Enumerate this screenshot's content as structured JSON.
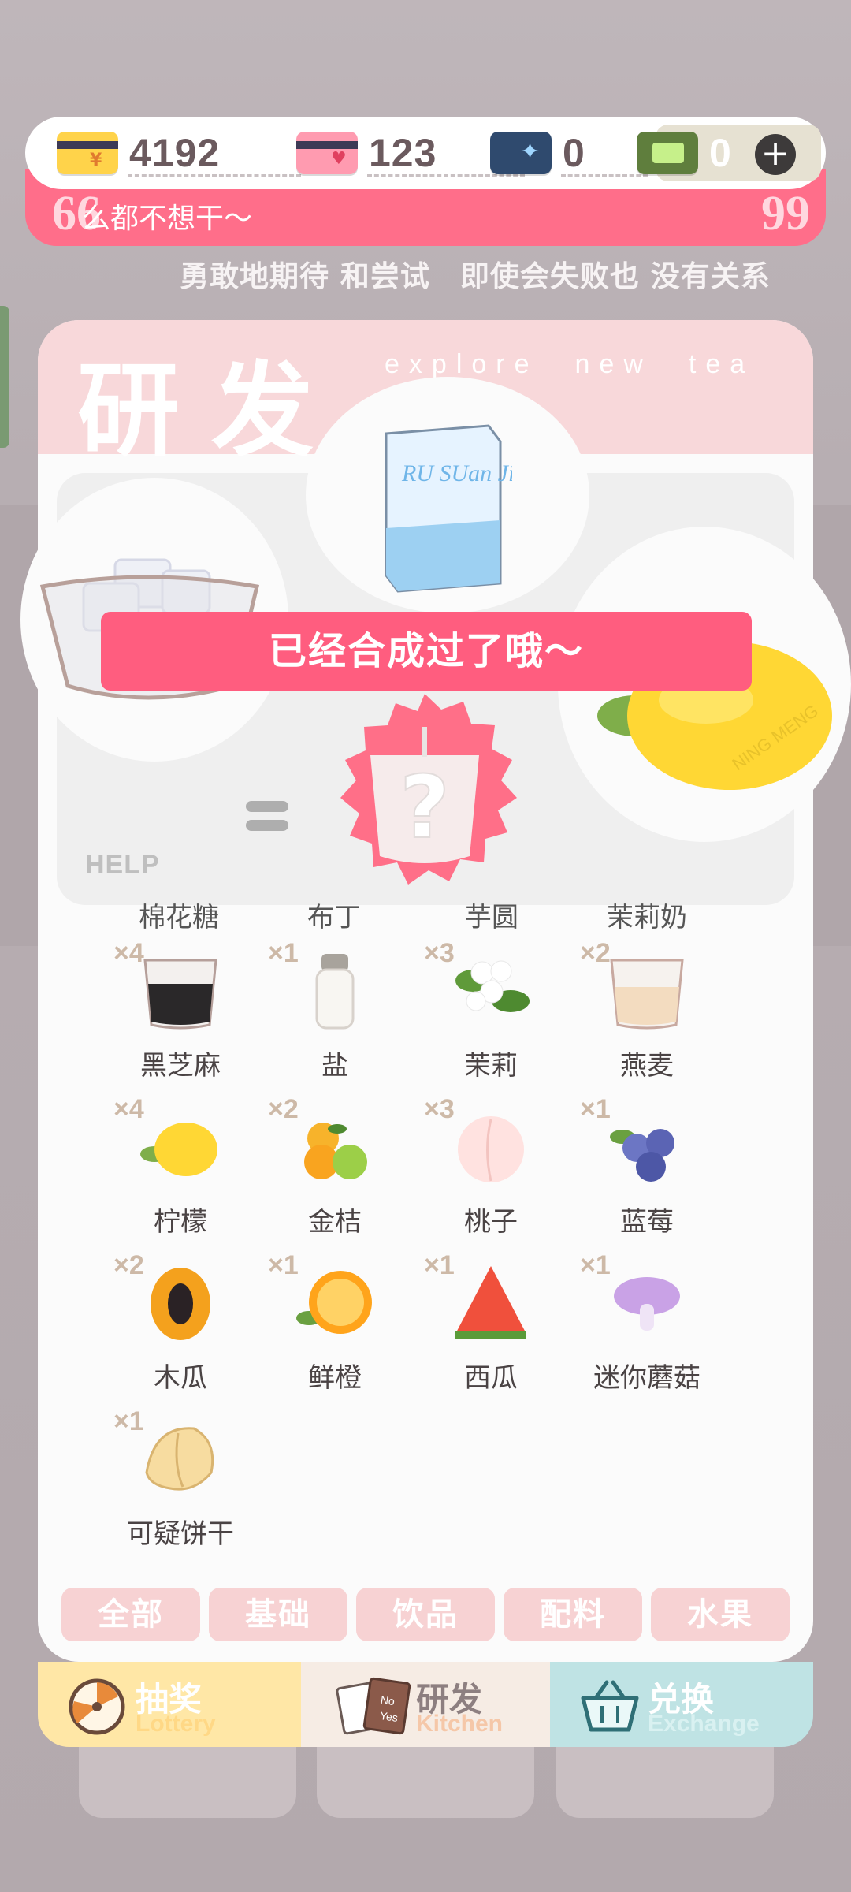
{
  "currency": [
    {
      "id": "gold-card",
      "value": "4192",
      "color": "#ffd34a"
    },
    {
      "id": "heart-card",
      "value": "123",
      "color": "#ff9bb0"
    },
    {
      "id": "ticket",
      "value": "0",
      "color": "#2f4a6e"
    },
    {
      "id": "cash",
      "value": "0",
      "color": "#5f7e3d"
    }
  ],
  "quote": {
    "text": "么都不想干～",
    "left_mark": "66",
    "right_mark": "99"
  },
  "motto": "勇敢地期待 和尝试　即使会失败也 没有关系",
  "panel": {
    "title": "研发",
    "subtitle": "explore　new　tea",
    "help": "HELP"
  },
  "toast": "已经合成过了哦～",
  "partial_names": [
    "棉花糖",
    "布丁",
    "芋圆",
    "茉莉奶"
  ],
  "ingredients": [
    {
      "qty": "×4",
      "name": "黑芝麻",
      "icon": "black-sesame-icon"
    },
    {
      "qty": "×1",
      "name": "盐",
      "icon": "salt-icon"
    },
    {
      "qty": "×3",
      "name": "茉莉",
      "icon": "jasmine-icon"
    },
    {
      "qty": "×2",
      "name": "燕麦",
      "icon": "oat-icon"
    },
    {
      "qty": "×4",
      "name": "柠檬",
      "icon": "lemon-icon"
    },
    {
      "qty": "×2",
      "name": "金桔",
      "icon": "kumquat-icon"
    },
    {
      "qty": "×3",
      "name": "桃子",
      "icon": "peach-icon"
    },
    {
      "qty": "×1",
      "name": "蓝莓",
      "icon": "blueberry-icon"
    },
    {
      "qty": "×2",
      "name": "木瓜",
      "icon": "papaya-icon"
    },
    {
      "qty": "×1",
      "name": "鲜橙",
      "icon": "orange-icon"
    },
    {
      "qty": "×1",
      "name": "西瓜",
      "icon": "watermelon-icon"
    },
    {
      "qty": "×1",
      "name": "迷你蘑菇",
      "icon": "mushroom-icon"
    },
    {
      "qty": "×1",
      "name": "可疑饼干",
      "icon": "fortune-cookie-icon"
    }
  ],
  "filters": [
    "全部",
    "基础",
    "饮品",
    "配料",
    "水果"
  ],
  "tabs": [
    {
      "label": "抽奖",
      "sub": "Lottery"
    },
    {
      "label": "研发",
      "sub": "Kitchen"
    },
    {
      "label": "兑换",
      "sub": "Exchange"
    }
  ],
  "carton_text": "RU SUan Jin",
  "lemon_text": "NING MENG",
  "badge_text": "?",
  "colors": {
    "accent": "#ff5d7f",
    "panel_head": "#f8d8da",
    "lottery": "#ffe7a6",
    "kitchen": "#f6ece4",
    "exchange": "#bfe3e4"
  }
}
